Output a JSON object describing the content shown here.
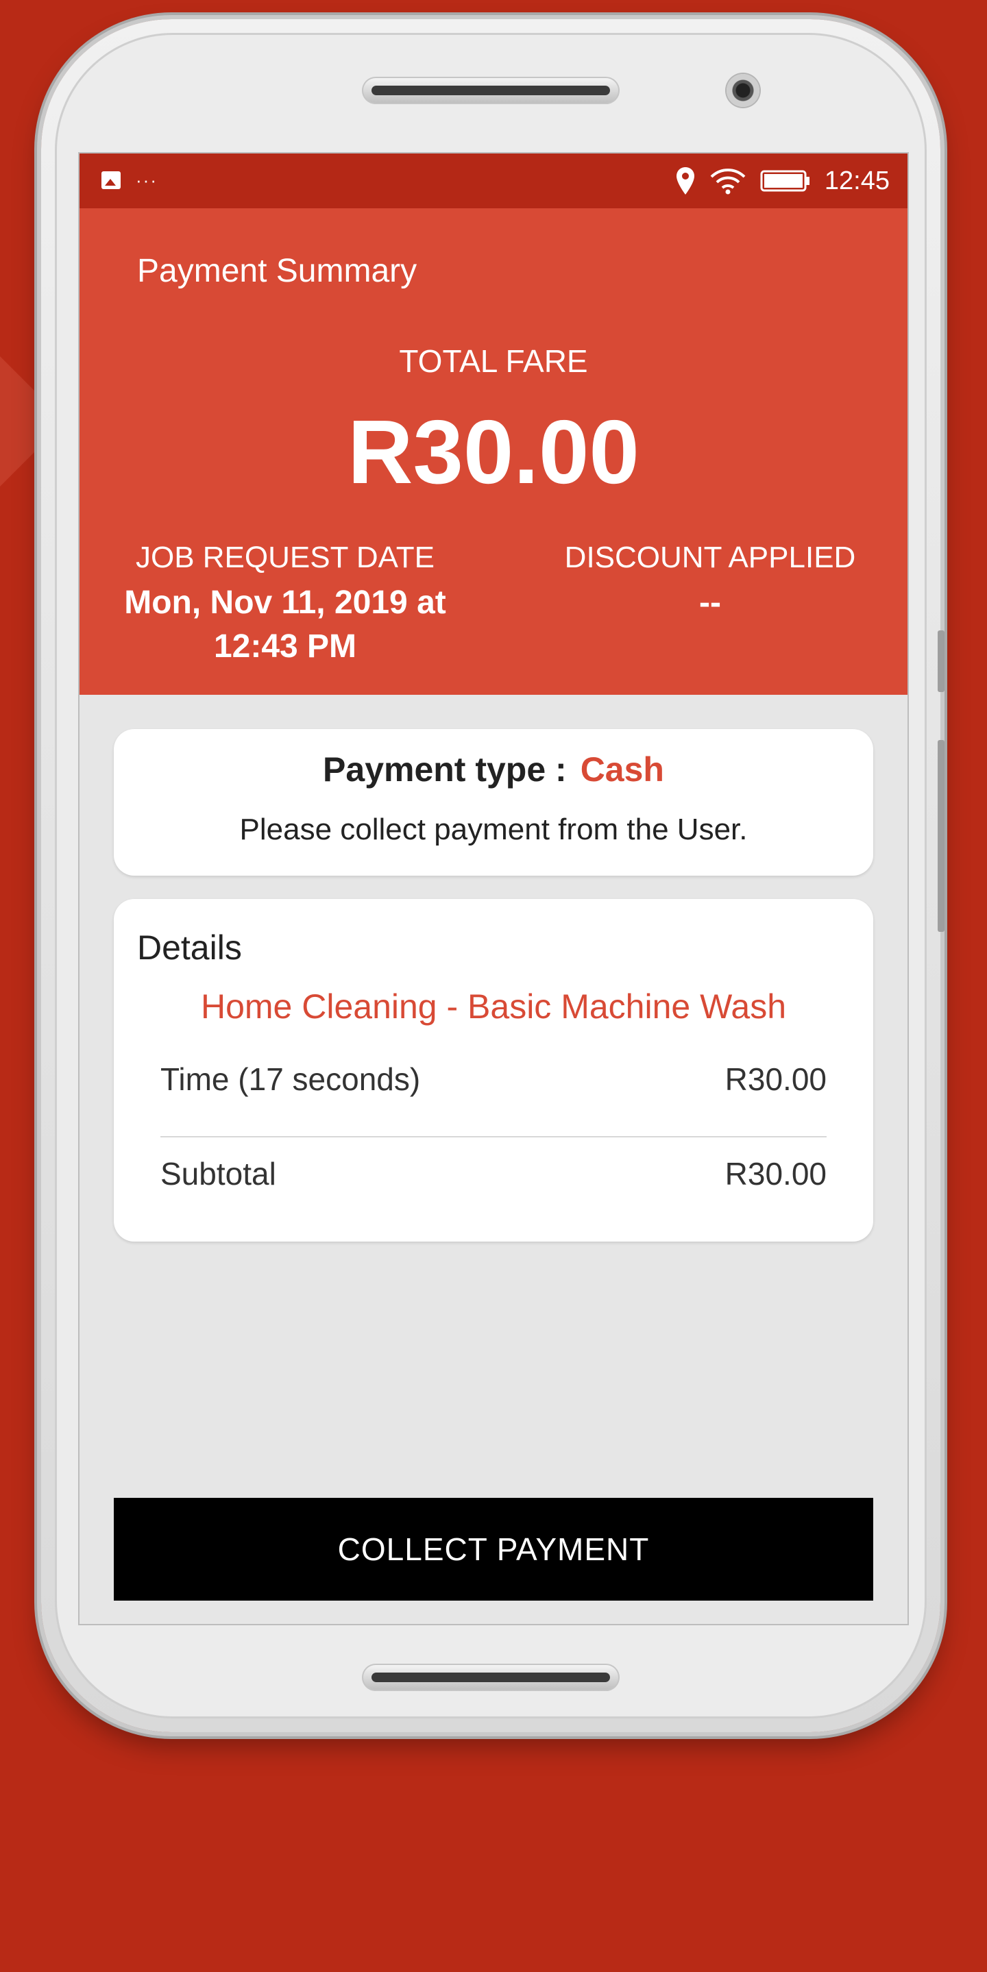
{
  "status_bar": {
    "time": "12:45",
    "more_indicator": "···",
    "icons": [
      "image-icon",
      "location-icon",
      "wifi-icon",
      "battery-icon"
    ]
  },
  "header": {
    "title": "Payment Summary",
    "total_fare_label": "TOTAL FARE",
    "total_fare_value": "R30.00",
    "job_request_date_label": "JOB REQUEST DATE",
    "job_request_date_line1": "Mon, Nov 11, 2019 at",
    "job_request_date_line2": "12:43 PM",
    "discount_label": "DISCOUNT APPLIED",
    "discount_value": "--"
  },
  "payment": {
    "type_label": "Payment type :",
    "type_value": "Cash",
    "note": "Please collect payment from the User."
  },
  "details": {
    "title": "Details",
    "service": "Home Cleaning - Basic Machine Wash",
    "rows": [
      {
        "label": "Time (17 seconds)",
        "value": "R30.00"
      },
      {
        "label": "Subtotal",
        "value": "R30.00"
      }
    ]
  },
  "actions": {
    "collect_label": "COLLECT PAYMENT"
  },
  "colors": {
    "status_bar": "#b42816",
    "header": "#d84a35",
    "accent": "#d84a35",
    "background": "#b82a16",
    "button": "#000000"
  }
}
